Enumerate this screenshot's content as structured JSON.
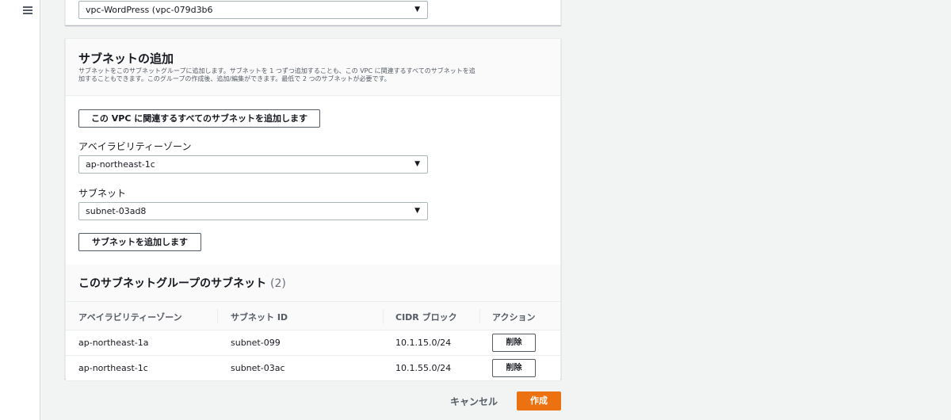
{
  "vpc_select": {
    "value": "vpc-WordPress (vpc-079d3b6",
    "arrow": "▼"
  },
  "add_subnets": {
    "title": "サブネットの追加",
    "description_line1": "サブネットをこのサブネットグループに追加します。サブネットを 1 つずつ追加することも、この VPC に関連するすべてのサブネットを追",
    "description_line2": "加することもできます。このグループの作成後、追加/編集ができます。最低で 2 つのサブネットが必要です。",
    "add_all_button": "この VPC に関連するすべてのサブネットを追加します",
    "az_label": "アベイラビリティーゾーン",
    "az_value": "ap-northeast-1c",
    "subnet_label": "サブネット",
    "subnet_value": "subnet-03ad8",
    "add_subnet_button": "サブネットを追加します"
  },
  "subnet_table": {
    "title": "このサブネットグループのサブネット",
    "count": "(2)",
    "headers": [
      "アベイラビリティーゾーン",
      "サブネット ID",
      "CIDR ブロック",
      "アクション"
    ],
    "rows": [
      {
        "az": "ap-northeast-1a",
        "subnet_id": "subnet-099",
        "cidr": "10.1.15.0/24",
        "action": "削除"
      },
      {
        "az": "ap-northeast-1c",
        "subnet_id": "subnet-03ac",
        "cidr": "10.1.55.0/24",
        "action": "削除"
      }
    ]
  },
  "footer": {
    "cancel": "キャンセル",
    "create": "作成"
  },
  "colors": {
    "primary": "#ec7211",
    "border": "#aab7b8",
    "background": "#f2f3f3"
  },
  "icons": {
    "menu": "hamburger-icon",
    "dropdown": "caret-down-icon"
  }
}
